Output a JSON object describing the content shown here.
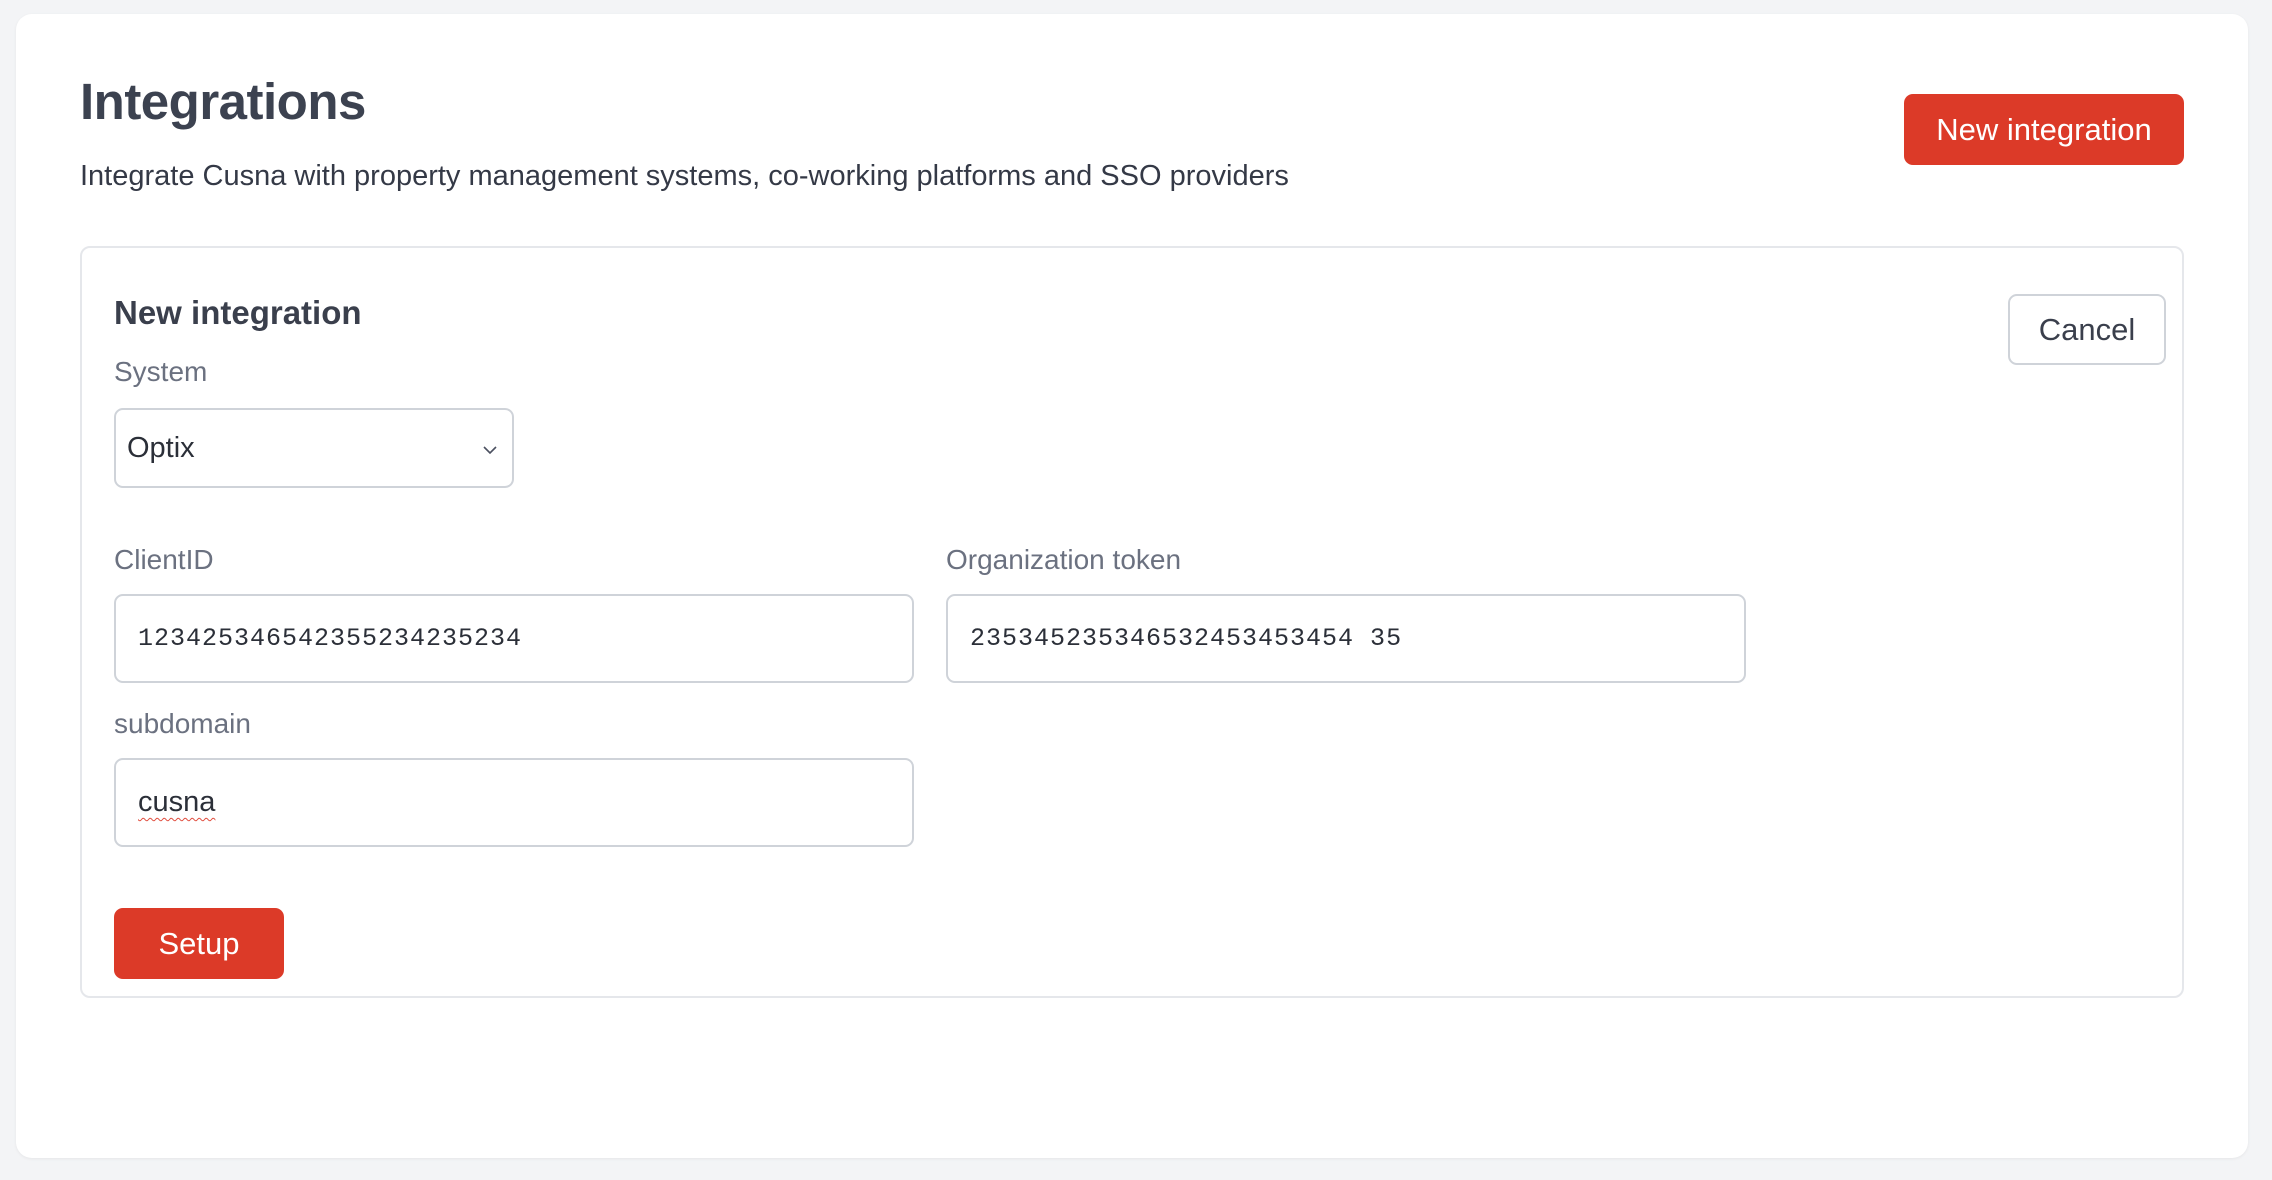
{
  "header": {
    "title": "Integrations",
    "subtitle": "Integrate Cusna with property management systems, co-working platforms and SSO providers",
    "new_button_label": "New integration"
  },
  "form": {
    "title": "New integration",
    "cancel_label": "Cancel",
    "system": {
      "label": "System",
      "selected": "Optix"
    },
    "client_id": {
      "label": "ClientID",
      "value": "12342534654235523423523​4"
    },
    "org_token": {
      "label": "Organization token",
      "value": "235345235346532453453454 35"
    },
    "subdomain": {
      "label": "subdomain",
      "value": "cusna"
    },
    "setup_label": "Setup"
  },
  "colors": {
    "accent": "#dc3a28",
    "border": "#cfd3d9",
    "page_bg": "#f3f4f6"
  },
  "icons": {
    "select_chevron": "chevron-down-icon"
  }
}
